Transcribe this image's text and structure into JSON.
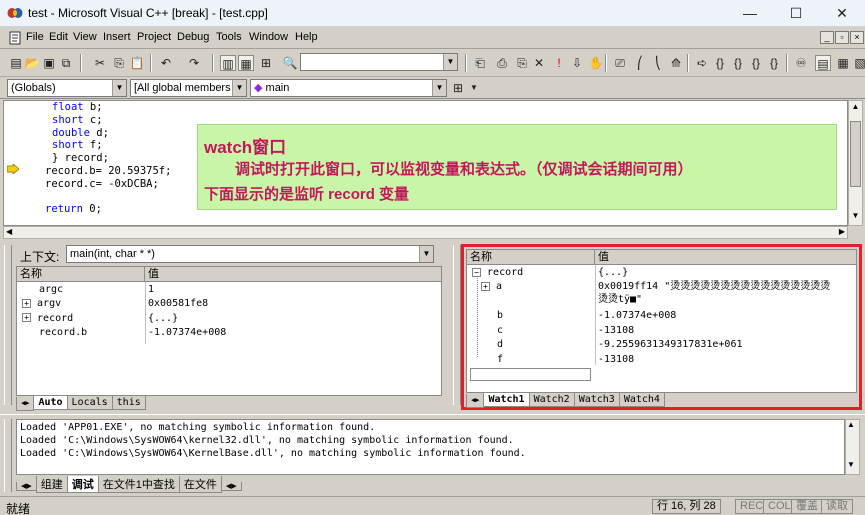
{
  "window": {
    "title": "test - Microsoft Visual C++ [break] - [test.cpp]",
    "minimize": "—",
    "maximize": "☐",
    "close": "✕"
  },
  "menu": {
    "items": [
      "File",
      "Edit",
      "View",
      "Insert",
      "Project",
      "Debug",
      "Tools",
      "Window",
      "Help"
    ]
  },
  "wizardbar": {
    "scope": "(Globals)",
    "members": "[All global members",
    "function": "main"
  },
  "editor": {
    "lines": [
      {
        "kw": "float",
        "rest": " b;"
      },
      {
        "kw": "short",
        "rest": " c;"
      },
      {
        "kw": "double",
        "rest": " d;"
      },
      {
        "kw": "short",
        "rest": " f;"
      },
      {
        "kw": "",
        "rest": "} record;"
      },
      {
        "kw": "",
        "rest": "record.b= 20.59375f;"
      },
      {
        "kw": "",
        "rest": "record.c= -0xDCBA;"
      },
      {
        "kw": "",
        "rest": ""
      },
      {
        "kw": "return",
        "rest": " 0;"
      }
    ]
  },
  "annotation": {
    "heading": "watch窗口",
    "line1": "调试时打开此窗口，可以监视变量和表达式。（仅调试会话期间可用）",
    "line2": "下面显示的是监听 record 变量"
  },
  "variables": {
    "context_label": "上下文:",
    "context_value": "main(int, char * *)",
    "col_name": "名称",
    "col_value": "值",
    "rows": [
      {
        "name": "argc",
        "value": "1"
      },
      {
        "name": "argv",
        "value": "0x00581fe8"
      },
      {
        "name": "record",
        "value": "{...}"
      },
      {
        "name": "record.b",
        "value": "-1.07374e+008"
      }
    ],
    "tabs": [
      "Auto",
      "Locals",
      "this"
    ]
  },
  "watch": {
    "col_name": "名称",
    "col_value": "值",
    "rows": [
      {
        "name": "record",
        "value": "{...}"
      },
      {
        "name": "a",
        "value": "0x0019ff14 \"烫烫烫烫烫烫烫烫烫烫烫烫烫烫烫烫"
      },
      {
        "name": "",
        "value": "烫烫tÿ■\""
      },
      {
        "name": "b",
        "value": "-1.07374e+008"
      },
      {
        "name": "c",
        "value": "-13108"
      },
      {
        "name": "d",
        "value": "-9.2559631349317831e+061"
      },
      {
        "name": "f",
        "value": "-13108"
      }
    ],
    "tabs": [
      "Watch1",
      "Watch2",
      "Watch3",
      "Watch4"
    ]
  },
  "output": {
    "lines": [
      "Loaded 'APP01.EXE', no matching symbolic information found.",
      "Loaded 'C:\\Windows\\SysWOW64\\kernel32.dll', no matching symbolic information found.",
      "Loaded 'C:\\Windows\\SysWOW64\\KernelBase.dll', no matching symbolic information found."
    ],
    "tabs": [
      "组建",
      "调试",
      "在文件1中查找",
      "在文件"
    ]
  },
  "status": {
    "ready": "就绪",
    "position": "行 16, 列 28",
    "rec": "REC",
    "col": "COL",
    "ovr": "覆盖",
    "read": "读取"
  }
}
